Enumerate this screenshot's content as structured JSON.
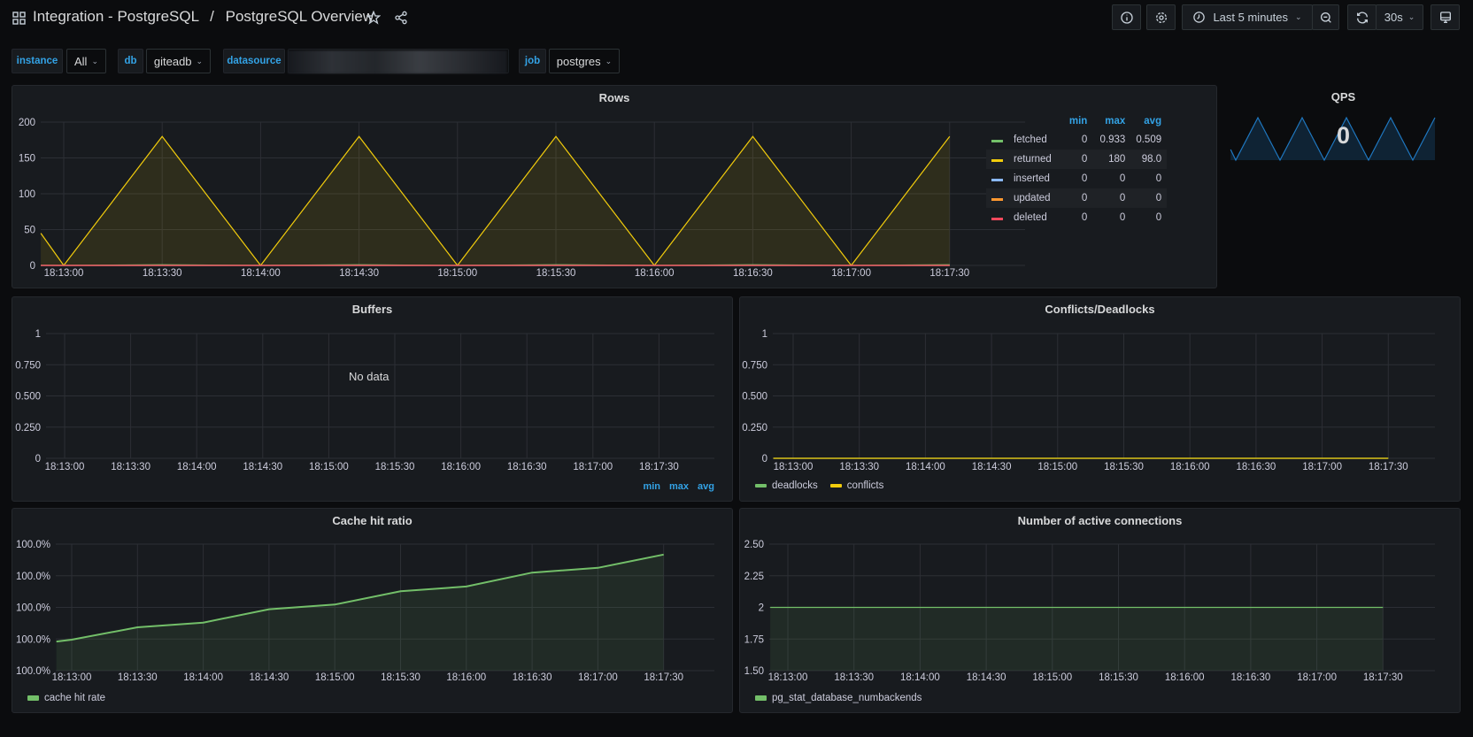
{
  "header": {
    "folder": "Integration - PostgreSQL",
    "separator": "/",
    "dashboard": "PostgreSQL Overview",
    "time_range": "Last 5 minutes",
    "refresh_interval": "30s",
    "icons": [
      "apps-icon",
      "star-icon",
      "share-icon",
      "info-icon",
      "gear-icon",
      "clock-icon",
      "zoom-out-icon",
      "refresh-icon",
      "tv-icon"
    ]
  },
  "variables": [
    {
      "label": "instance",
      "value": "All"
    },
    {
      "label": "db",
      "value": "giteadb"
    },
    {
      "label": "datasource",
      "value": ""
    },
    {
      "label": "job",
      "value": "postgres"
    }
  ],
  "colors": {
    "accent": "#33a2e5",
    "green": "#73bf69",
    "yellow": "#fade2a",
    "cyan": "#5794f2",
    "orange": "#ff9830",
    "red": "#f2495c",
    "qps": "#1f78c1"
  },
  "panels": {
    "rows": {
      "title": "Rows",
      "legend_headers": [
        "min",
        "max",
        "avg"
      ],
      "legend": [
        {
          "name": "fetched",
          "color": "#73bf69",
          "min": "0",
          "max": "0.933",
          "avg": "0.509"
        },
        {
          "name": "returned",
          "color": "#f2cc0c",
          "min": "0",
          "max": "180",
          "avg": "98.0"
        },
        {
          "name": "inserted",
          "color": "#8ab8ff",
          "min": "0",
          "max": "0",
          "avg": "0"
        },
        {
          "name": "updated",
          "color": "#ff9830",
          "min": "0",
          "max": "0",
          "avg": "0"
        },
        {
          "name": "deleted",
          "color": "#f2495c",
          "min": "0",
          "max": "0",
          "avg": "0"
        }
      ]
    },
    "qps": {
      "title": "QPS",
      "value": "0"
    },
    "buffers": {
      "title": "Buffers",
      "no_data": "No data",
      "legend_headers": [
        "min",
        "max",
        "avg"
      ]
    },
    "conflicts": {
      "title": "Conflicts/Deadlocks",
      "legend": [
        {
          "name": "deadlocks",
          "color": "#73bf69"
        },
        {
          "name": "conflicts",
          "color": "#f2cc0c"
        }
      ]
    },
    "cache": {
      "title": "Cache hit ratio",
      "legend": [
        {
          "name": "cache hit rate",
          "color": "#73bf69"
        }
      ]
    },
    "connections": {
      "title": "Number of active connections",
      "legend": [
        {
          "name": "pg_stat_database_numbackends",
          "color": "#73bf69"
        }
      ]
    }
  },
  "chart_data": [
    {
      "id": "rows",
      "type": "line",
      "title": "Rows",
      "ylim": [
        0,
        200
      ],
      "yticks": [
        "0",
        "50",
        "100",
        "150",
        "200"
      ],
      "xticks": [
        "18:13:00",
        "18:13:30",
        "18:14:00",
        "18:14:30",
        "18:15:00",
        "18:15:30",
        "18:16:00",
        "18:16:30",
        "18:17:00",
        "18:17:30"
      ],
      "x": [
        "18:12:53",
        "18:13:00",
        "18:13:30",
        "18:14:00",
        "18:14:30",
        "18:15:00",
        "18:15:30",
        "18:16:00",
        "18:16:30",
        "18:17:00",
        "18:17:30"
      ],
      "series": [
        {
          "name": "returned",
          "color": "#f2cc0c",
          "fill": true,
          "values": [
            45,
            0,
            180,
            0,
            180,
            0,
            180,
            0,
            180,
            0,
            180
          ]
        },
        {
          "name": "fetched",
          "color": "#73bf69",
          "values": [
            0.2,
            0,
            0.933,
            0,
            0.933,
            0,
            0.933,
            0,
            0.933,
            0,
            0.933
          ]
        },
        {
          "name": "inserted",
          "color": "#8ab8ff",
          "values": [
            0,
            0,
            0,
            0,
            0,
            0,
            0,
            0,
            0,
            0,
            0
          ]
        },
        {
          "name": "updated",
          "color": "#ff9830",
          "values": [
            0,
            0,
            0,
            0,
            0,
            0,
            0,
            0,
            0,
            0,
            0
          ]
        },
        {
          "name": "deleted",
          "color": "#f2495c",
          "values": [
            0,
            0,
            0,
            0,
            0,
            0,
            0,
            0,
            0,
            0,
            0
          ]
        }
      ],
      "grid": true,
      "legend": "right"
    },
    {
      "id": "qps",
      "type": "area",
      "x": [
        "18:12:53",
        "18:13:00",
        "18:13:30",
        "18:14:00",
        "18:14:30",
        "18:15:00",
        "18:15:30",
        "18:16:00",
        "18:16:30",
        "18:17:00",
        "18:17:30"
      ],
      "series": [
        {
          "color": "#1f78c1",
          "values": [
            45,
            0,
            180,
            0,
            180,
            0,
            180,
            0,
            180,
            0,
            180
          ]
        }
      ],
      "ylim": [
        0,
        180
      ]
    },
    {
      "id": "buffers",
      "type": "line",
      "ylim": [
        0,
        1
      ],
      "yticks": [
        "0",
        "0.250",
        "0.500",
        "0.750",
        "1"
      ],
      "xticks": [
        "18:13:00",
        "18:13:30",
        "18:14:00",
        "18:14:30",
        "18:15:00",
        "18:15:30",
        "18:16:00",
        "18:16:30",
        "18:17:00",
        "18:17:30"
      ],
      "x": [],
      "series": [],
      "grid": true
    },
    {
      "id": "conflicts",
      "type": "line",
      "ylim": [
        0,
        1
      ],
      "yticks": [
        "0",
        "0.250",
        "0.500",
        "0.750",
        "1"
      ],
      "xticks": [
        "18:13:00",
        "18:13:30",
        "18:14:00",
        "18:14:30",
        "18:15:00",
        "18:15:30",
        "18:16:00",
        "18:16:30",
        "18:17:00",
        "18:17:30"
      ],
      "x": [
        "18:12:51",
        "18:17:30"
      ],
      "series": [
        {
          "name": "deadlocks",
          "color": "#73bf69",
          "values": [
            0,
            0
          ]
        },
        {
          "name": "conflicts",
          "color": "#f2cc0c",
          "values": [
            0,
            0
          ]
        }
      ],
      "grid": true,
      "legend": "bottom"
    },
    {
      "id": "cache",
      "type": "area",
      "ylim": [
        99.96,
        100.0
      ],
      "yticks": [
        "100.0%",
        "100.0%",
        "100.0%",
        "100.0%",
        "100.0%"
      ],
      "xticks": [
        "18:13:00",
        "18:13:30",
        "18:14:00",
        "18:14:30",
        "18:15:00",
        "18:15:30",
        "18:16:00",
        "18:16:30",
        "18:17:00",
        "18:17:30"
      ],
      "x": [
        "18:12:53",
        "18:13:00",
        "18:13:30",
        "18:14:00",
        "18:14:30",
        "18:15:00",
        "18:15:30",
        "18:16:00",
        "18:16:30",
        "18:17:00",
        "18:17:30"
      ],
      "series": [
        {
          "name": "cache hit rate",
          "color": "#73bf69",
          "fill": true,
          "values": [
            99.9692,
            99.9698,
            99.9737,
            99.9752,
            99.9794,
            99.9809,
            99.9851,
            99.9866,
            99.991,
            99.9925,
            99.9967
          ]
        }
      ],
      "grid": true,
      "legend": "bottom"
    },
    {
      "id": "connections",
      "type": "area",
      "ylim": [
        1.5,
        2.5
      ],
      "yticks": [
        "1.50",
        "1.75",
        "2",
        "2.25",
        "2.50"
      ],
      "xticks": [
        "18:13:00",
        "18:13:30",
        "18:14:00",
        "18:14:30",
        "18:15:00",
        "18:15:30",
        "18:16:00",
        "18:16:30",
        "18:17:00",
        "18:17:30"
      ],
      "x": [
        "18:12:52",
        "18:17:30"
      ],
      "series": [
        {
          "name": "pg_stat_database_numbackends",
          "color": "#73bf69",
          "fill": true,
          "values": [
            2,
            2
          ]
        }
      ],
      "grid": true,
      "legend": "bottom"
    }
  ]
}
